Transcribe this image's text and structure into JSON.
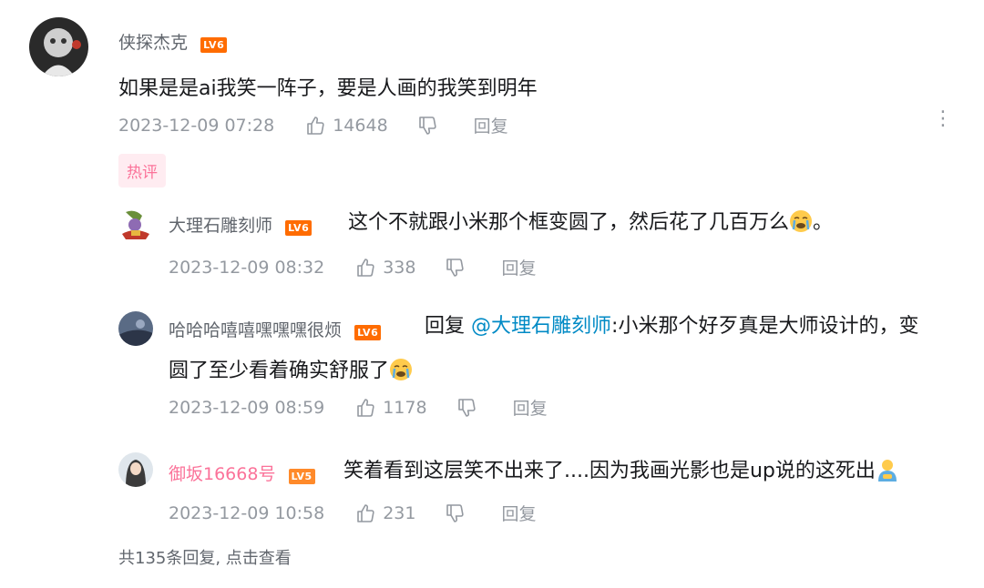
{
  "comment": {
    "username": "侠探杰克",
    "level": "LV6",
    "text": "如果是是ai我笑一阵子，要是人画的我笑到明年",
    "time": "2023-12-09 07:28",
    "likes": "14648",
    "reply_label": "回复",
    "hot_tag": "热评",
    "more_glyph": "⋮"
  },
  "replies": [
    {
      "username": "大理石雕刻师",
      "level": "LV6",
      "text": "这个不就跟小米那个框变圆了，然后花了几百万么",
      "text_after_emoji": "。",
      "time": "2023-12-09 08:32",
      "likes": "338",
      "reply_label": "回复"
    },
    {
      "username": "哈哈哈嘻嘻嘿嘿嘿很烦",
      "level": "LV6",
      "reply_prefix": "回复",
      "mention": "@大理石雕刻师",
      "text_line1": ":小米那个好歹真是大师设计的，变",
      "text_line2": "圆了至少看着确实舒服了",
      "time": "2023-12-09 08:59",
      "likes": "1178",
      "reply_label": "回复"
    },
    {
      "username": "御坂16668号",
      "level": "LV5",
      "text": "笑着看到这层笑不出来了....因为我画光影也是up说的这死出",
      "time": "2023-12-09 10:58",
      "likes": "231",
      "reply_label": "回复"
    }
  ],
  "footer": {
    "total_replies": "共135条回复, 点击查看"
  },
  "colors": {
    "username_pink": "#fb7299",
    "mention_blue": "#008ac5",
    "level_orange": "#ff6c00"
  }
}
